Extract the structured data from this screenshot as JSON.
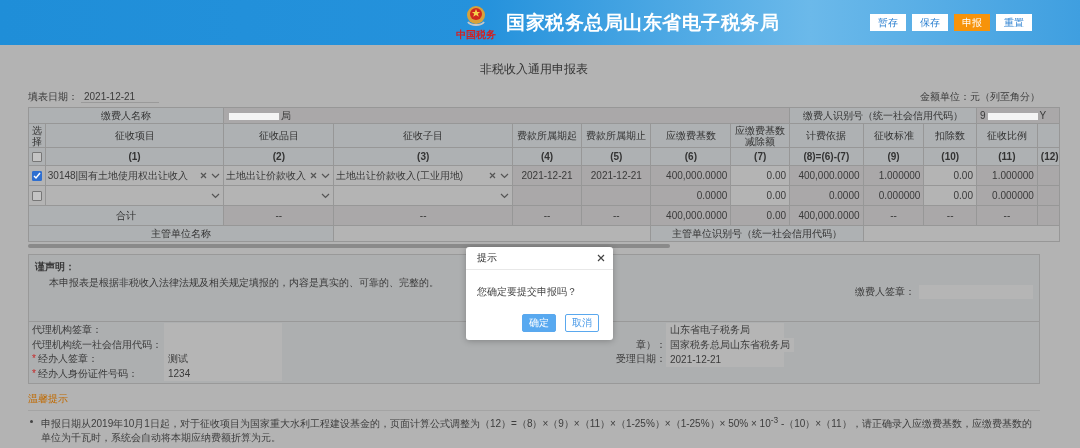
{
  "header": {
    "logo_text": "中国税务",
    "title": "国家税务总局山东省电子税务局",
    "buttons": [
      {
        "label": "暂存",
        "primary": false
      },
      {
        "label": "保存",
        "primary": false
      },
      {
        "label": "申报",
        "primary": true
      },
      {
        "label": "重置",
        "primary": false
      }
    ]
  },
  "form": {
    "title": "非税收入通用申报表",
    "fill_date": {
      "label": "填表日期：",
      "value": "2021-12-21"
    },
    "unit_note": "金额单位：元（列至角分）"
  },
  "table": {
    "payer_name_label": "缴费人名称",
    "payer_name_end": "局",
    "payer_id_label": "缴费人识别号（统一社会信用代码）",
    "payer_id_start": "9",
    "payer_id_end": "Y",
    "select_header": "选择",
    "header_checkbox": {
      "checked": false
    },
    "columns": [
      {
        "title": "征收项目",
        "number": "(1)"
      },
      {
        "title": "征收品目",
        "number": "(2)"
      },
      {
        "title": "征收子目",
        "number": "(3)"
      },
      {
        "title": "费款所属期起",
        "number": "(4)"
      },
      {
        "title": "费款所属期止",
        "number": "(5)"
      },
      {
        "title": "应缴费基数",
        "number": "(6)"
      },
      {
        "title": "应缴费基数减除额",
        "number": "(7)"
      },
      {
        "title": "计费依据",
        "number": "(8)=(6)-(7)"
      },
      {
        "title": "征收标准",
        "number": "(9)"
      },
      {
        "title": "扣除数",
        "number": "(10)"
      },
      {
        "title": "征收比例",
        "number": "(11)"
      },
      {
        "number": "(12)"
      }
    ],
    "rows": [
      {
        "checked": true,
        "cells": [
          {
            "kind": "select",
            "value": "30148|国有土地使用权出让收入",
            "clearable": true
          },
          {
            "kind": "select",
            "value": "土地出让价款收入",
            "clearable": true
          },
          {
            "kind": "select",
            "value": "土地出让价款收入(工业用地)",
            "clearable": true
          },
          {
            "kind": "text",
            "value": "2021-12-21"
          },
          {
            "kind": "text",
            "value": "2021-12-21"
          },
          {
            "kind": "text",
            "value": "400,000.0000"
          },
          {
            "kind": "text",
            "value": "0.00"
          },
          {
            "kind": "text",
            "value": "400,000.0000"
          },
          {
            "kind": "text",
            "value": "1.000000"
          },
          {
            "kind": "text",
            "value": "0.00"
          },
          {
            "kind": "text",
            "value": "1.000000"
          }
        ]
      },
      {
        "checked": false,
        "cells": [
          {
            "kind": "select",
            "clearable": false
          },
          {
            "kind": "select",
            "clearable": false
          },
          {
            "kind": "select",
            "clearable": false
          },
          {
            "kind": "text"
          },
          {
            "kind": "text"
          },
          {
            "kind": "text",
            "value": "0.0000"
          },
          {
            "kind": "text",
            "value": "0.00"
          },
          {
            "kind": "text",
            "value": "0.0000"
          },
          {
            "kind": "text",
            "value": "0.000000"
          },
          {
            "kind": "text",
            "value": "0.00"
          },
          {
            "kind": "text",
            "value": "0.000000"
          }
        ]
      }
    ],
    "totals": {
      "label": "合计",
      "cells": [
        "--",
        "--",
        "--",
        "--",
        "400,000.0000",
        "0.00",
        "400,000.0000",
        "--",
        "--",
        "--"
      ]
    },
    "authority_name_label": "主管单位名称",
    "authority_id_label": "主管单位识别号（统一社会信用代码）"
  },
  "declaration": {
    "heading": "谨声明：",
    "text": "本申报表是根据非税收入法律法规及相关规定填报的，内容是真实的、可靠的、完整的。",
    "signature_label": "缴费人签章："
  },
  "agent": {
    "required_mark": "*",
    "left": [
      {
        "label": "代理机构签章：",
        "required": false
      },
      {
        "label": "代理机构统一社会信用代码：",
        "required": false
      },
      {
        "label": "经办人签章：",
        "required": true,
        "value": "测试"
      },
      {
        "label": "经办人身份证件号码：",
        "required": true,
        "value": "1234"
      }
    ],
    "right": [
      {
        "value": "山东省电子税务局"
      },
      {
        "label": "章）：",
        "value": "国家税务总局山东省税务局"
      },
      {
        "label": "受理日期：",
        "value": "2021-12-21"
      }
    ]
  },
  "tips": {
    "heading": "温馨提示",
    "items": [
      "申报日期从2019年10月1日起，对于征收项目为国家重大水利工程建设基金的，页面计算公式调整为（12）=（8）×（9）×（11）×（1-25%）×（1-25%）× 50% × 10$^{-3}$ -（10）×（11），请正确录入应缴费基数，应缴费基数的单位为千瓦时，系统会自动将本期应纳费额折算为元。"
    ]
  },
  "modal": {
    "title": "提示",
    "message": "您确定要提交申报吗？",
    "buttons": [
      {
        "label": "确定",
        "primary": true
      },
      {
        "label": "取消",
        "primary": false
      }
    ]
  }
}
